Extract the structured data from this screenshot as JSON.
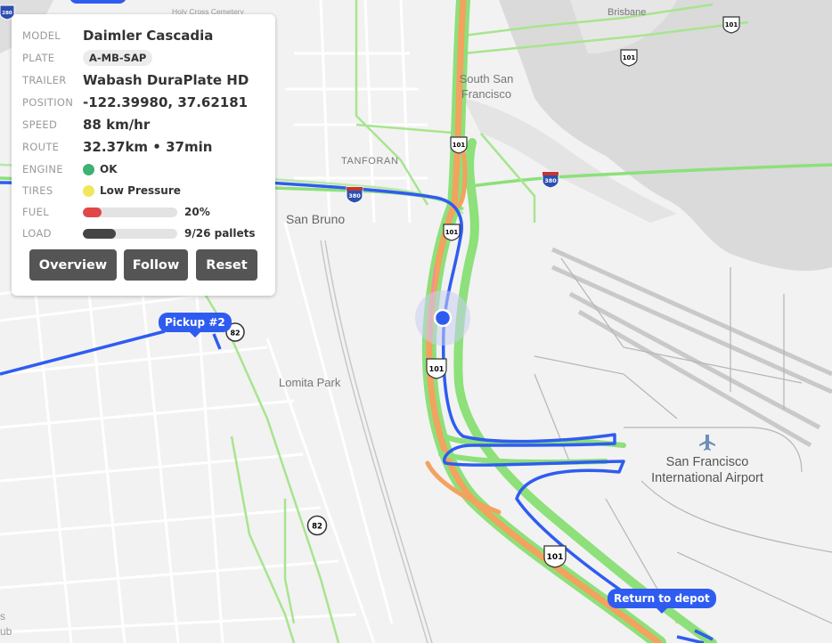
{
  "vehicle": {
    "model_label": "MODEL",
    "model": "Daimler Cascadia",
    "plate_label": "PLATE",
    "plate": "A-MB-SAP",
    "trailer_label": "TRAILER",
    "trailer": "Wabash DuraPlate HD",
    "position_label": "POSITION",
    "position": "-122.39980, 37.62181",
    "speed_label": "SPEED",
    "speed": "88 km/hr",
    "route_label": "ROUTE",
    "route": "32.37km • 37min",
    "engine_label": "ENGINE",
    "engine": "OK",
    "engine_color": "#3cb371",
    "tires_label": "TIRES",
    "tires": "Low Pressure",
    "tires_color": "#f0e85a",
    "fuel_label": "FUEL",
    "fuel": "20%",
    "fuel_fraction": 0.2,
    "fuel_color": "#e04848",
    "load_label": "LOAD",
    "load": "9/26 pallets",
    "load_fraction": 0.346,
    "load_color": "#444444"
  },
  "buttons": {
    "overview": "Overview",
    "follow": "Follow",
    "reset": "Reset"
  },
  "map": {
    "places": {
      "brisbane": "Brisbane",
      "south_sf_1": "South San",
      "south_sf_2": "Francisco",
      "tanforan": "TANFORAN",
      "san_bruno": "San Bruno",
      "lomita_park": "Lomita Park",
      "holy_cross": "Holy Cross Cemetery",
      "airport_1": "San Francisco",
      "airport_2": "International Airport"
    },
    "shields": {
      "us101": "101",
      "i380": "380",
      "sr82": "82",
      "i280": "280"
    },
    "tags": {
      "pickup": "Pickup #2",
      "depot": "Return to depot"
    },
    "edge_text": {
      "s": "s",
      "ub": "ub"
    },
    "colors": {
      "route": "#2f5cf0",
      "traffic_green": "#8de07a",
      "traffic_orange": "#f3a25f",
      "water": "#dadada"
    }
  }
}
